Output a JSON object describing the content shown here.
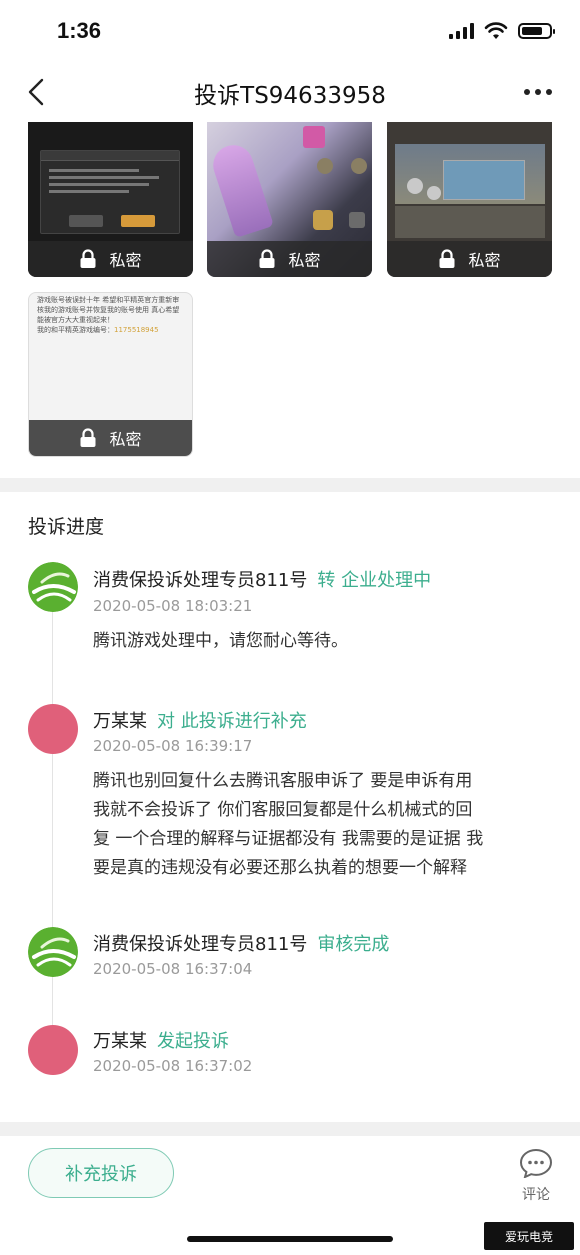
{
  "status_bar": {
    "time": "1:36"
  },
  "nav": {
    "title": "投诉TS94633958"
  },
  "images": {
    "private_label": "私密",
    "text_card_lines": [
      "游戏账号被误封十年 希望和平精英官方重新审",
      "核我的游戏账号并恢复我的账号使用 真心希望",
      "能被官方大大重视起来！",
      "我的和平精英游戏编号："
    ],
    "text_card_game_id": "1175518945"
  },
  "progress": {
    "title": "投诉进度",
    "items": [
      {
        "name": "消费保投诉处理专员811号",
        "action": "转 企业处理中",
        "time": "2020-05-08 18:03:21",
        "content": [
          "腾讯游戏处理中，请您耐心等待。"
        ]
      },
      {
        "name": "万某某",
        "action": "对 此投诉进行补充",
        "time": "2020-05-08 16:39:17",
        "content": [
          "腾讯也别回复什么去腾讯客服申诉了 要是申诉有用",
          "我就不会投诉了 你们客服回复都是什么机械式的回",
          "复 一个合理的解释与证据都没有 我需要的是证据 我",
          "要是真的违规没有必要还那么执着的想要一个解释"
        ]
      },
      {
        "name": "消费保投诉处理专员811号",
        "action": "审核完成",
        "time": "2020-05-08 16:37:04",
        "content": []
      },
      {
        "name": "万某某",
        "action": "发起投诉",
        "time": "2020-05-08 16:37:02",
        "content": []
      }
    ]
  },
  "bottom": {
    "supplement_label": "补充投诉",
    "comment_label": "评论"
  },
  "watermark": {
    "text": "爱玩电竞"
  },
  "colors": {
    "accent": "#3cae8e",
    "avatar_pink": "#e0607a",
    "avatar_green": "#5ab030"
  }
}
